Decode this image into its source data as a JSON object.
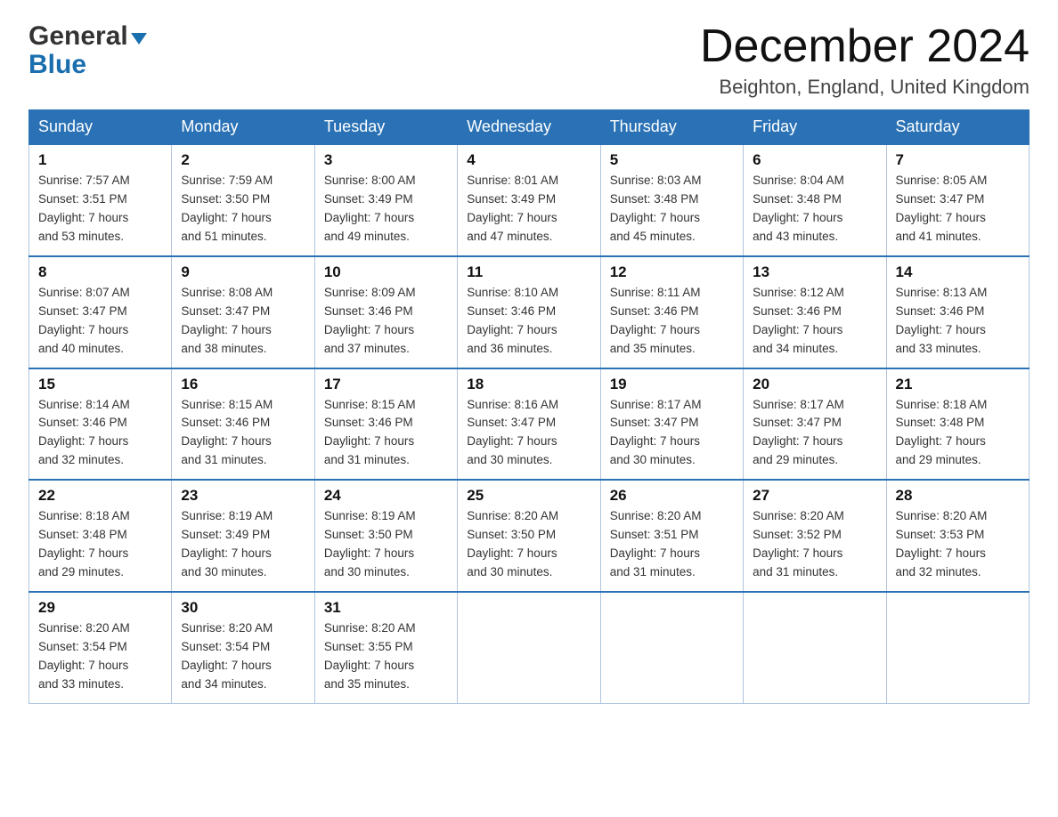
{
  "header": {
    "logo_general": "General",
    "logo_blue": "Blue",
    "month_title": "December 2024",
    "location": "Beighton, England, United Kingdom"
  },
  "days_of_week": [
    "Sunday",
    "Monday",
    "Tuesday",
    "Wednesday",
    "Thursday",
    "Friday",
    "Saturday"
  ],
  "weeks": [
    [
      {
        "day": "1",
        "sunrise": "7:57 AM",
        "sunset": "3:51 PM",
        "daylight": "7 hours and 53 minutes."
      },
      {
        "day": "2",
        "sunrise": "7:59 AM",
        "sunset": "3:50 PM",
        "daylight": "7 hours and 51 minutes."
      },
      {
        "day": "3",
        "sunrise": "8:00 AM",
        "sunset": "3:49 PM",
        "daylight": "7 hours and 49 minutes."
      },
      {
        "day": "4",
        "sunrise": "8:01 AM",
        "sunset": "3:49 PM",
        "daylight": "7 hours and 47 minutes."
      },
      {
        "day": "5",
        "sunrise": "8:03 AM",
        "sunset": "3:48 PM",
        "daylight": "7 hours and 45 minutes."
      },
      {
        "day": "6",
        "sunrise": "8:04 AM",
        "sunset": "3:48 PM",
        "daylight": "7 hours and 43 minutes."
      },
      {
        "day": "7",
        "sunrise": "8:05 AM",
        "sunset": "3:47 PM",
        "daylight": "7 hours and 41 minutes."
      }
    ],
    [
      {
        "day": "8",
        "sunrise": "8:07 AM",
        "sunset": "3:47 PM",
        "daylight": "7 hours and 40 minutes."
      },
      {
        "day": "9",
        "sunrise": "8:08 AM",
        "sunset": "3:47 PM",
        "daylight": "7 hours and 38 minutes."
      },
      {
        "day": "10",
        "sunrise": "8:09 AM",
        "sunset": "3:46 PM",
        "daylight": "7 hours and 37 minutes."
      },
      {
        "day": "11",
        "sunrise": "8:10 AM",
        "sunset": "3:46 PM",
        "daylight": "7 hours and 36 minutes."
      },
      {
        "day": "12",
        "sunrise": "8:11 AM",
        "sunset": "3:46 PM",
        "daylight": "7 hours and 35 minutes."
      },
      {
        "day": "13",
        "sunrise": "8:12 AM",
        "sunset": "3:46 PM",
        "daylight": "7 hours and 34 minutes."
      },
      {
        "day": "14",
        "sunrise": "8:13 AM",
        "sunset": "3:46 PM",
        "daylight": "7 hours and 33 minutes."
      }
    ],
    [
      {
        "day": "15",
        "sunrise": "8:14 AM",
        "sunset": "3:46 PM",
        "daylight": "7 hours and 32 minutes."
      },
      {
        "day": "16",
        "sunrise": "8:15 AM",
        "sunset": "3:46 PM",
        "daylight": "7 hours and 31 minutes."
      },
      {
        "day": "17",
        "sunrise": "8:15 AM",
        "sunset": "3:46 PM",
        "daylight": "7 hours and 31 minutes."
      },
      {
        "day": "18",
        "sunrise": "8:16 AM",
        "sunset": "3:47 PM",
        "daylight": "7 hours and 30 minutes."
      },
      {
        "day": "19",
        "sunrise": "8:17 AM",
        "sunset": "3:47 PM",
        "daylight": "7 hours and 30 minutes."
      },
      {
        "day": "20",
        "sunrise": "8:17 AM",
        "sunset": "3:47 PM",
        "daylight": "7 hours and 29 minutes."
      },
      {
        "day": "21",
        "sunrise": "8:18 AM",
        "sunset": "3:48 PM",
        "daylight": "7 hours and 29 minutes."
      }
    ],
    [
      {
        "day": "22",
        "sunrise": "8:18 AM",
        "sunset": "3:48 PM",
        "daylight": "7 hours and 29 minutes."
      },
      {
        "day": "23",
        "sunrise": "8:19 AM",
        "sunset": "3:49 PM",
        "daylight": "7 hours and 30 minutes."
      },
      {
        "day": "24",
        "sunrise": "8:19 AM",
        "sunset": "3:50 PM",
        "daylight": "7 hours and 30 minutes."
      },
      {
        "day": "25",
        "sunrise": "8:20 AM",
        "sunset": "3:50 PM",
        "daylight": "7 hours and 30 minutes."
      },
      {
        "day": "26",
        "sunrise": "8:20 AM",
        "sunset": "3:51 PM",
        "daylight": "7 hours and 31 minutes."
      },
      {
        "day": "27",
        "sunrise": "8:20 AM",
        "sunset": "3:52 PM",
        "daylight": "7 hours and 31 minutes."
      },
      {
        "day": "28",
        "sunrise": "8:20 AM",
        "sunset": "3:53 PM",
        "daylight": "7 hours and 32 minutes."
      }
    ],
    [
      {
        "day": "29",
        "sunrise": "8:20 AM",
        "sunset": "3:54 PM",
        "daylight": "7 hours and 33 minutes."
      },
      {
        "day": "30",
        "sunrise": "8:20 AM",
        "sunset": "3:54 PM",
        "daylight": "7 hours and 34 minutes."
      },
      {
        "day": "31",
        "sunrise": "8:20 AM",
        "sunset": "3:55 PM",
        "daylight": "7 hours and 35 minutes."
      },
      null,
      null,
      null,
      null
    ]
  ],
  "labels": {
    "sunrise": "Sunrise: ",
    "sunset": "Sunset: ",
    "daylight": "Daylight: "
  }
}
